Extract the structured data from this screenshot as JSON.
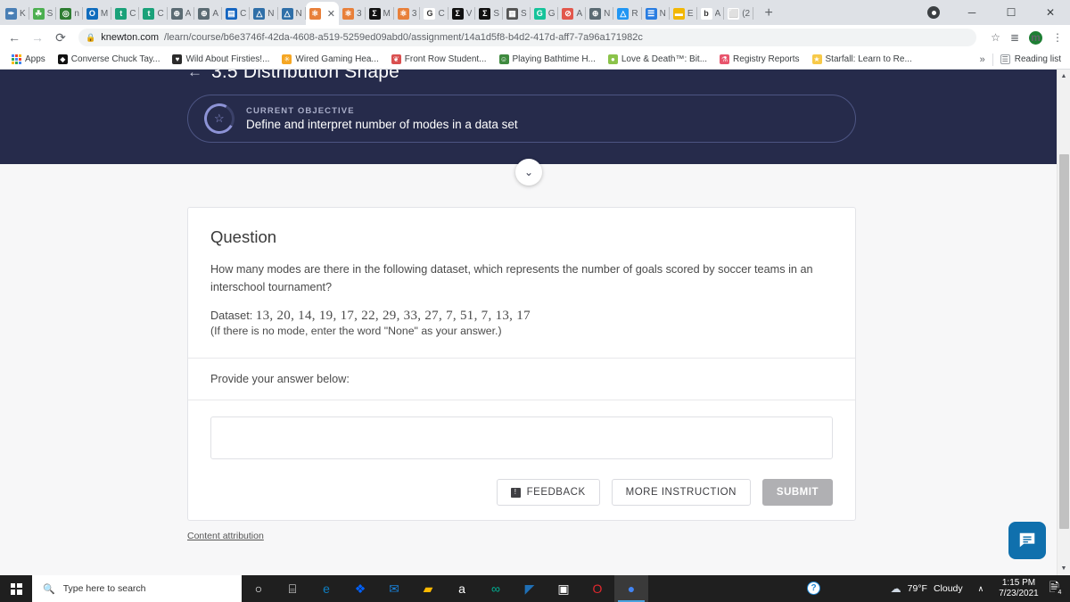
{
  "browser": {
    "tabs": [
      {
        "label": "K",
        "icon": "gradebook-icon",
        "color": "#4a7fb5",
        "glyph": "✒",
        "active": false
      },
      {
        "label": "S",
        "icon": "seesaw-icon",
        "color": "#4caf50",
        "glyph": "☘",
        "active": false
      },
      {
        "label": "n",
        "icon": "nearpod-icon",
        "color": "#2e7d32",
        "glyph": "◎",
        "active": false
      },
      {
        "label": "M",
        "icon": "outlook-icon",
        "color": "#0f6cbd",
        "glyph": "O",
        "active": false
      },
      {
        "label": "C",
        "icon": "teachers-pay-icon",
        "color": "#1aa179",
        "glyph": "t",
        "active": false
      },
      {
        "label": "C",
        "icon": "teachers-pay-icon-2",
        "color": "#1aa179",
        "glyph": "t",
        "active": false
      },
      {
        "label": "A",
        "icon": "globe-icon",
        "color": "#5b6b73",
        "glyph": "⊕",
        "active": false
      },
      {
        "label": "A",
        "icon": "globe-icon-2",
        "color": "#5b6b73",
        "glyph": "⊕",
        "active": false
      },
      {
        "label": "C",
        "icon": "book-icon",
        "color": "#1565c0",
        "glyph": "▤",
        "active": false
      },
      {
        "label": "N",
        "icon": "newsela-icon",
        "color": "#2f6fa8",
        "glyph": "△",
        "active": false
      },
      {
        "label": "N",
        "icon": "newsela-icon-2",
        "color": "#2f6fa8",
        "glyph": "△",
        "active": false
      },
      {
        "label": "",
        "icon": "knewton-atom-icon",
        "color": "#e8803a",
        "glyph": "⚛",
        "active": true
      },
      {
        "label": "3",
        "icon": "knewton-atom-icon-2",
        "color": "#e8803a",
        "glyph": "⚛",
        "active": false
      },
      {
        "label": "M",
        "icon": "sigma-icon",
        "color": "#111111",
        "glyph": "Σ",
        "active": false
      },
      {
        "label": "3",
        "icon": "knewton-atom-icon-3",
        "color": "#e8803a",
        "glyph": "⚛",
        "active": false
      },
      {
        "label": "C",
        "icon": "google-icon",
        "color": "#ffffff",
        "glyph": "G",
        "active": false
      },
      {
        "label": "V",
        "icon": "sigma-icon-2",
        "color": "#111111",
        "glyph": "Σ",
        "active": false
      },
      {
        "label": "S",
        "icon": "sigma-icon-3",
        "color": "#111111",
        "glyph": "Σ",
        "active": false
      },
      {
        "label": "S",
        "icon": "calculator-icon",
        "color": "#555555",
        "glyph": "▦",
        "active": false
      },
      {
        "label": "G",
        "icon": "grammarly-icon",
        "color": "#15c39a",
        "glyph": "G",
        "active": false
      },
      {
        "label": "A",
        "icon": "scribd-icon",
        "color": "#e2574c",
        "glyph": "⊘",
        "active": false
      },
      {
        "label": "N",
        "icon": "globe-icon-3",
        "color": "#5b6b73",
        "glyph": "⊕",
        "active": false
      },
      {
        "label": "R",
        "icon": "google-drive-icon",
        "color": "#2196f3",
        "glyph": "△",
        "active": false
      },
      {
        "label": "N",
        "icon": "google-docs-icon",
        "color": "#2a7de1",
        "glyph": "☰",
        "active": false
      },
      {
        "label": "E",
        "icon": "yellow-bar-icon",
        "color": "#f2b705",
        "glyph": "▬",
        "active": false
      },
      {
        "label": "A",
        "icon": "bold-b-icon",
        "color": "#ffffff",
        "glyph": "b",
        "active": false
      },
      {
        "label": "(2",
        "icon": "speaker-icon",
        "color": "#ffffff",
        "glyph": "⬜",
        "active": false
      }
    ],
    "new_tab_label": "+",
    "nav": {
      "back": "←",
      "forward": "→",
      "reload": "⟳"
    },
    "url": {
      "lock_icon": "lock-icon",
      "host": "knewton.com",
      "path": "/learn/course/b6e3746f-42da-4608-a519-5259ed09abd0/assignment/14a1d5f8-b4d2-417d-aff7-7a96a171982c"
    },
    "toolbar_icons": {
      "star": "☆",
      "reading_list": "≣",
      "avatar": "m",
      "menu": "⋮"
    },
    "window_controls": {
      "minimize": "─",
      "maximize": "☐",
      "close": "✕"
    },
    "bookmarks": [
      {
        "label": "Apps",
        "icon": "apps-grid-icon",
        "color": "",
        "glyph": ""
      },
      {
        "label": "Converse Chuck Tay...",
        "icon": "converse-icon",
        "color": "#111111",
        "glyph": "◆"
      },
      {
        "label": "Wild About Firsties!...",
        "icon": "heart-icon",
        "color": "#2b2b2b",
        "glyph": "♥"
      },
      {
        "label": "Wired Gaming Hea...",
        "icon": "sparkle-icon",
        "color": "#f5a623",
        "glyph": "✳"
      },
      {
        "label": "Front Row Student...",
        "icon": "bull-icon",
        "color": "#d94f4f",
        "glyph": "❦"
      },
      {
        "label": "Playing Bathtime H...",
        "icon": "green-person-icon",
        "color": "#3f8a3f",
        "glyph": "☺"
      },
      {
        "label": "Love & Death™: Bit...",
        "icon": "lime-icon",
        "color": "#8bc34a",
        "glyph": "●"
      },
      {
        "label": "Registry Reports",
        "icon": "gift-icon",
        "color": "#e8556d",
        "glyph": "⚗"
      },
      {
        "label": "Starfall: Learn to Re...",
        "icon": "star-icon",
        "color": "#f7c948",
        "glyph": "★"
      }
    ],
    "bookmarks_overflow": "»",
    "reading_list": "Reading list"
  },
  "page": {
    "title": "3.5 Distribution Shape",
    "back_label": "←",
    "objective": {
      "kicker": "CURRENT OBJECTIVE",
      "text": "Define and interpret number of modes in a data set",
      "star_glyph": "☆"
    },
    "collapse_glyph": "⌄",
    "question": {
      "heading": "Question",
      "body": "How many modes are there in the following dataset, which represents the number of goals scored by soccer teams in an interschool tournament?",
      "dataset_label": "Dataset:",
      "dataset_values": "13,  20,  14,  19,  17,  22,  29,  33,  27,  7,  51,  7,  13,  17",
      "hint": "(If there is no mode, enter the word \"None\" as your answer.)",
      "provide_label": "Provide your answer below:",
      "answer_value": "",
      "answer_placeholder": ""
    },
    "buttons": {
      "feedback": "FEEDBACK",
      "feedback_icon": "⚑",
      "more_instruction": "MORE INSTRUCTION",
      "submit": "SUBMIT"
    },
    "content_attribution": "Content attribution",
    "chat_icon": "chat-bubble-icon"
  },
  "taskbar": {
    "search_placeholder": "Type here to search",
    "search_icon": "magnifier-icon",
    "start_icon": "windows-logo-icon",
    "apps": [
      {
        "name": "cortana-icon",
        "glyph": "○",
        "color": "#ffffff"
      },
      {
        "name": "task-view-icon",
        "glyph": "⌸",
        "color": "#ffffff"
      },
      {
        "name": "microsoft-edge-icon",
        "glyph": "e",
        "color": "#0e7ec1"
      },
      {
        "name": "dropbox-icon",
        "glyph": "❖",
        "color": "#0061ff"
      },
      {
        "name": "mail-icon",
        "glyph": "✉",
        "color": "#1a7fd4"
      },
      {
        "name": "file-explorer-icon",
        "glyph": "▰",
        "color": "#ffb900"
      },
      {
        "name": "amazon-icon",
        "glyph": "a",
        "color": "#ffffff"
      },
      {
        "name": "bing-icon",
        "glyph": "∞",
        "color": "#00b294"
      },
      {
        "name": "photos-icon",
        "glyph": "◤",
        "color": "#1f6fb5"
      },
      {
        "name": "microsoft-store-icon",
        "glyph": "▣",
        "color": "#ffffff"
      },
      {
        "name": "opera-icon",
        "glyph": "O",
        "color": "#e3282e"
      },
      {
        "name": "google-chrome-icon",
        "glyph": "●",
        "color": "#4285f4"
      }
    ],
    "help_icon": "?",
    "weather": {
      "temp": "79°F",
      "condition": "Cloudy",
      "icon": "cloud-icon"
    },
    "tray_chevron": "∧",
    "clock": {
      "time": "1:15 PM",
      "date": "7/23/2021"
    },
    "notification": {
      "icon": "notification-icon",
      "count": "4"
    }
  }
}
